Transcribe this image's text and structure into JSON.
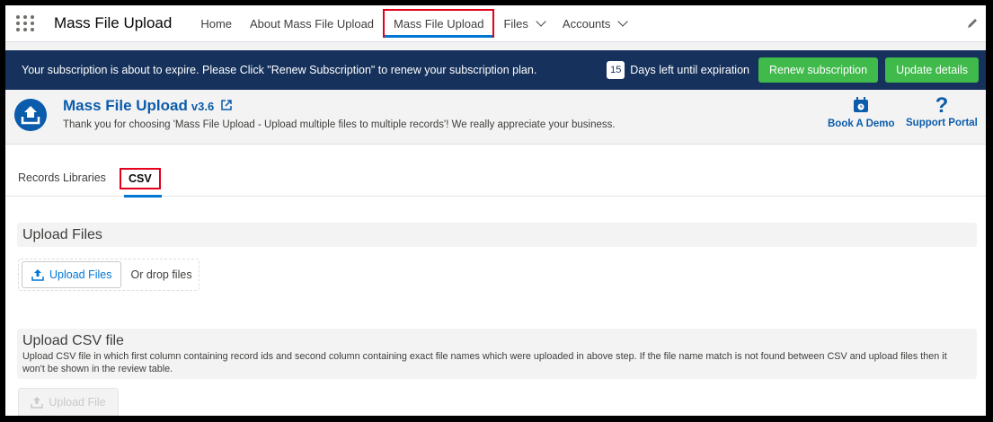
{
  "nav": {
    "app_name": "Mass File Upload",
    "items": [
      {
        "label": "Home"
      },
      {
        "label": "About Mass File Upload"
      },
      {
        "label": "Mass File Upload"
      },
      {
        "label": "Files"
      },
      {
        "label": "Accounts"
      }
    ]
  },
  "banner": {
    "message": "Your subscription is about to expire. Please Click \"Renew Subscription\" to renew your subscription plan.",
    "days_count": "15",
    "days_label": "Days left until expiration",
    "renew_label": "Renew subscription",
    "update_label": "Update details"
  },
  "header": {
    "title": "Mass File Upload",
    "version": "v3.6",
    "thanks": "Thank you for choosing 'Mass File Upload - Upload multiple files to multiple records'! We really appreciate your business.",
    "book_demo": "Book A Demo",
    "support": "Support Portal"
  },
  "tabs": [
    {
      "label": "Records"
    },
    {
      "label": "Libraries"
    },
    {
      "label": "CSV"
    }
  ],
  "upload_files": {
    "title": "Upload Files",
    "button": "Upload Files",
    "drop": "Or drop files"
  },
  "upload_csv": {
    "title": "Upload CSV file",
    "description": "Upload CSV file in which first column containing record ids and second column containing exact file names which were uploaded in above step. If the file name match is not found between CSV and upload files then it won't be shown in the review table.",
    "button": "Upload File"
  },
  "colors": {
    "accent": "#0176d3",
    "banner": "#16325c",
    "green": "#3fba4b",
    "highlight": "#e2001a"
  }
}
